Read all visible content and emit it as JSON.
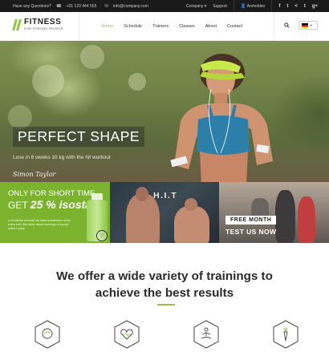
{
  "topbar": {
    "question": "Have any Questions?",
    "phone": "+01 123 444 555",
    "email": "info@company.com",
    "company": "Company",
    "support": "Support",
    "account": "Anmelden",
    "social_icons": [
      "facebook-icon",
      "twitter-icon",
      "share-icon",
      "tumblr-icon",
      "google-plus-icon"
    ],
    "social_glyphs": [
      "f",
      "t",
      "<",
      "t",
      "g+"
    ]
  },
  "nav": {
    "logo_title": "FITNESS",
    "logo_tagline": "FOR STRONG PEOPLE",
    "items": [
      "Home",
      "Schedule",
      "Trainers",
      "Classes",
      "About",
      "Contact"
    ],
    "active": "Home",
    "accent": "#8dc63f"
  },
  "hero": {
    "title": "PERFECT SHAPE",
    "subtitle": "Lose in 6 weeks 10 kg with the hit workout",
    "signature": "Simon Taylor"
  },
  "promo": {
    "limited_line1": "ONLY FOR SHORT TIME",
    "limited_line2_prefix": "GET",
    "limited_line2_big": "25 % isostar",
    "limited_text": "A wonderful serenity has taken possession of my entire soul, like these sweet mornings of spring which I enjoy",
    "hit_label": "H.I.T",
    "free_month": "FREE MONTH",
    "test_now": "TEST US NOW"
  },
  "intro": {
    "headline_line1": "We offer a wide variety of trainings to",
    "headline_line2": "achieve the best results"
  },
  "features": [
    "brain-icon",
    "heart-health-icon",
    "meditation-icon",
    "carrot-icon"
  ]
}
